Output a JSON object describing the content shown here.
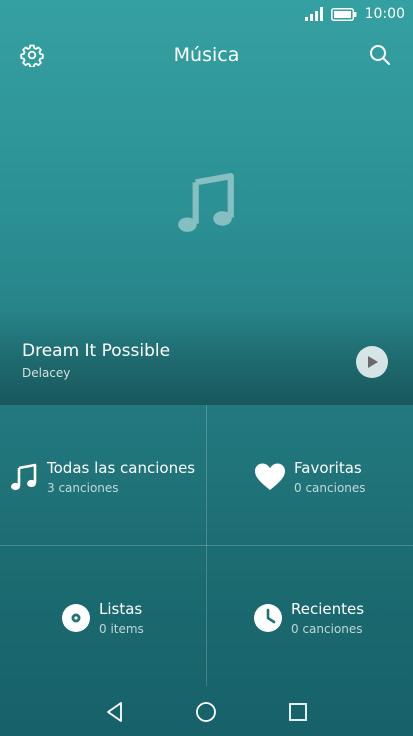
{
  "status": {
    "time": "10:00",
    "icons": [
      "signal-icon",
      "battery-icon"
    ]
  },
  "app_bar": {
    "title": "Música",
    "left_icon": "gear-icon",
    "right_icon": "search-icon"
  },
  "now_playing": {
    "title": "Dream It Possible",
    "artist": "Delacey",
    "art_icon": "music-note-icon",
    "action_icon": "play-icon"
  },
  "library": {
    "all_songs": {
      "label": "Todas las canciones",
      "count": "3 canciones",
      "icon": "music-note-icon"
    },
    "favorites": {
      "label": "Favoritas",
      "count": "0 canciones",
      "icon": "heart-icon"
    },
    "playlists": {
      "label": "Listas",
      "count": "0 items",
      "icon": "disc-icon"
    },
    "recent": {
      "label": "Recientes",
      "count": "0 canciones",
      "icon": "clock-icon"
    }
  },
  "nav": {
    "icons": [
      "back-icon",
      "home-icon",
      "recents-icon"
    ]
  },
  "colors": {
    "bg_top": "#35a0a2",
    "bg_bottom": "#17616a",
    "foreground": "#ffffff"
  }
}
